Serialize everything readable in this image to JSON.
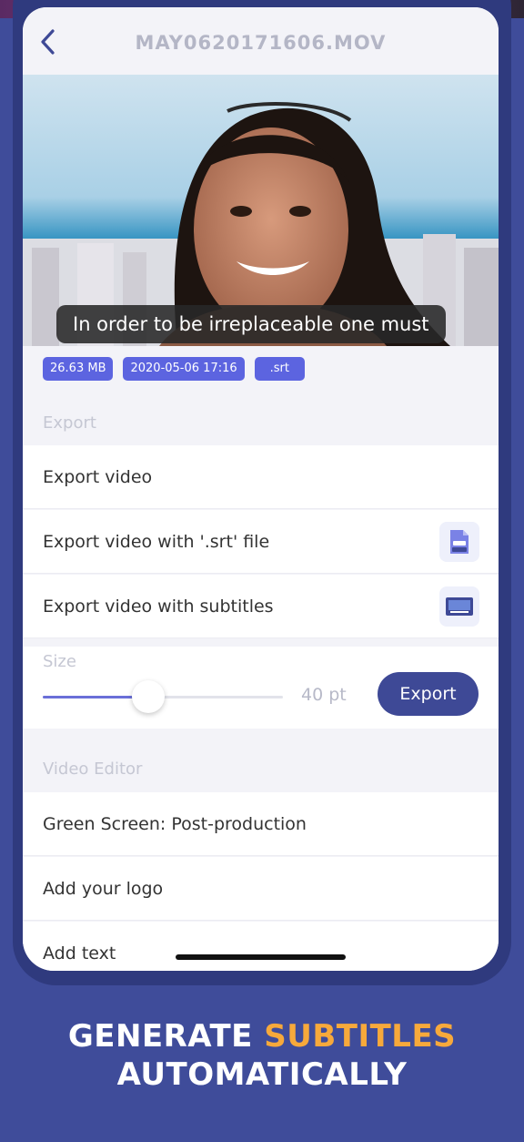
{
  "header": {
    "title": "MAY0620171606.MOV",
    "back_icon": "chevron-left-icon"
  },
  "video": {
    "subtitle": "In order to be irreplaceable one must"
  },
  "tags": {
    "size": "26.63 MB",
    "date": "2020-05-06 17:16",
    "format": ".srt"
  },
  "export_section": {
    "label": "Export",
    "items": [
      {
        "label": "Export video"
      },
      {
        "label": "Export video with '.srt' file",
        "icon": "srt-file-icon"
      },
      {
        "label": "Export video with subtitles",
        "icon": "subtitles-icon"
      }
    ],
    "size": {
      "label": "Size",
      "value_text": "40 pt",
      "fraction": 0.44,
      "button": "Export"
    }
  },
  "video_editor_section": {
    "label": "Video Editor",
    "items": [
      {
        "label": "Green Screen: Post-production"
      },
      {
        "label": "Add your logo"
      },
      {
        "label": "Add text"
      }
    ]
  },
  "promo": {
    "line1_prefix": "GENERATE",
    "line1_accent": "SUBTITLES",
    "line2": "AUTOMATICALLY"
  },
  "colors": {
    "background": "#3f4c9a",
    "tag": "#5c64e0",
    "accent": "#f7a93b",
    "button": "#3e4996"
  }
}
